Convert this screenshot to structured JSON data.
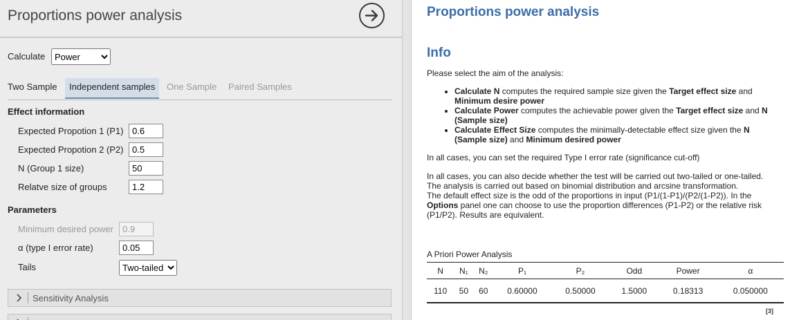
{
  "left": {
    "title": "Proportions power analysis",
    "calculate": {
      "label": "Calculate",
      "selected": "Power",
      "options": [
        "Power"
      ]
    },
    "tabs": [
      {
        "label": "Two Sample",
        "state": "normal"
      },
      {
        "label": "Independent samples",
        "state": "selected"
      },
      {
        "label": "One Sample",
        "state": "disabled"
      },
      {
        "label": "Paired Samples",
        "state": "disabled"
      }
    ],
    "effect": {
      "heading": "Effect information",
      "p1": {
        "label": "Expected Propotion 1 (P1)",
        "value": "0.6"
      },
      "p2": {
        "label": "Expected Propotion 2 (P2)",
        "value": "0.5"
      },
      "n": {
        "label": "N (Group 1 size)",
        "value": "50"
      },
      "ratio": {
        "label": "Relatve size of groups",
        "value": "1.2"
      }
    },
    "parameters": {
      "heading": "Parameters",
      "power": {
        "label": "Minimum desired power",
        "value": "0.9"
      },
      "alpha": {
        "label": "α (type I error rate)",
        "value": "0.05"
      },
      "tails": {
        "label": "Tails",
        "selected": "Two-tailed",
        "options": [
          "Two-tailed"
        ]
      }
    },
    "sensitivity": {
      "label": "Sensitivity Analysis"
    }
  },
  "right": {
    "title": "Proportions power analysis",
    "info_heading": "Info",
    "intro": "Please select the aim of the analysis:",
    "bullets": [
      {
        "b1": "Calculate N",
        "t1": " computes the required sample size given the ",
        "b2": "Target effect size",
        "t2": " and ",
        "b3": "Minimum desire power",
        "t3": ""
      },
      {
        "b1": "Calculate Power",
        "t1": " computes the achievable power given the ",
        "b2": "Target effect size",
        "t2": " and ",
        "b3": "N (Sample size)",
        "t3": ""
      },
      {
        "b1": "Calculate Effect Size",
        "t1": " computes the minimally-detectable effect size given the ",
        "b2": "N (Sample size)",
        "t2": " and ",
        "b3": "Minimum desired power",
        "t3": ""
      }
    ],
    "para1": "In all cases, you can set the required Type I error rate (significance cut-off)",
    "para2_line1": "In all cases, you can also decide whether the test will be carried out two-tailed or one-tailed.",
    "para2_line2": "The analysis is carried out based on binomial distribution and arcsine transformation.",
    "para2_line3": "The default effect size is the odd of the proportions in input (P1/(1-P1)/(P2/(1-P2)). In the ",
    "para2_bold": "Options",
    "para2_line4": " panel one can choose to use the proportion differences (P1-P2) or the relative risk (P1/P2). Results are equivalent.",
    "table": {
      "title": "A Priori Power Analysis",
      "headers": [
        "N",
        "N₁",
        "N₂",
        "P₁",
        "P₂",
        "Odd",
        "Power",
        "α"
      ],
      "row": [
        "110",
        "50",
        "60",
        "0.60000",
        "0.50000",
        "1.5000",
        "0.18313",
        "0.050000"
      ],
      "footnote": "[3]"
    }
  }
}
